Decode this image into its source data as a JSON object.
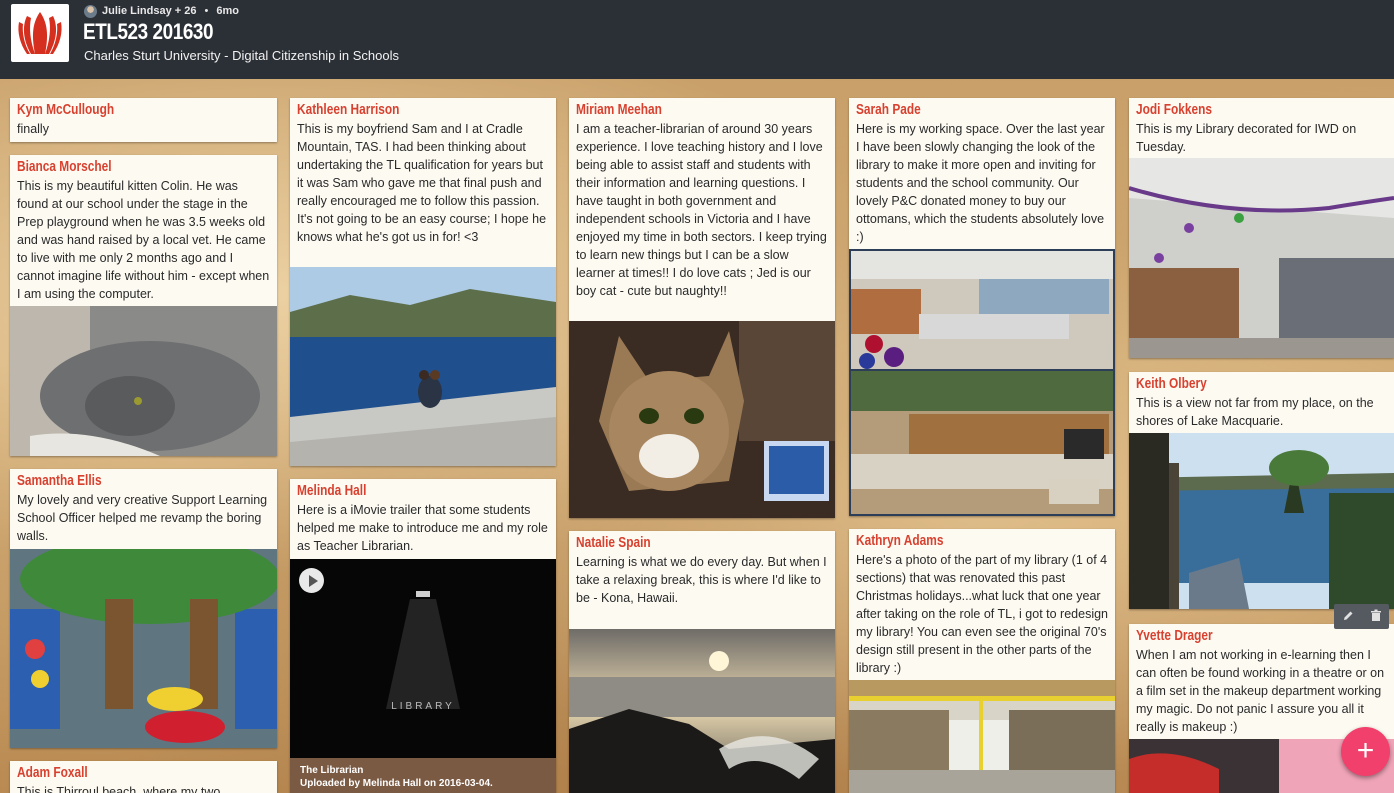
{
  "header": {
    "author_meta": "Julie Lindsay + 26",
    "age": "6mo",
    "title": "ETL523 201630",
    "subtitle": "Charles Sturt University - Digital Citizenship in Schools"
  },
  "posts": [
    {
      "author": "Kym McCullough",
      "text": "finally"
    },
    {
      "author": "Bianca Morschel",
      "text": "This is my beautiful kitten Colin. He was found at our school under the stage in the Prep playground when he was 3.5 weeks old and was hand raised by a local vet. He came to live with me only 2 months ago and I cannot imagine life without him - except when I am using the computer."
    },
    {
      "author": "Samantha Ellis",
      "text": "My lovely and very creative Support Learning School Officer helped me revamp the boring walls."
    },
    {
      "author": "Adam Foxall",
      "text": "This is Thirroul beach, where my two"
    },
    {
      "author": "Kathleen Harrison",
      "text": "This is my boyfriend Sam and I at Cradle Mountain, TAS. I had been thinking about undertaking the TL qualification for years but it was Sam who gave me that final push and really encouraged me to follow this passion. It's not going to be an easy course; I hope he knows what he's got us in for! <3"
    },
    {
      "author": "Melinda Hall",
      "text": "Here is a iMovie trailer that some students helped me make to introduce me and my role as Teacher Librarian."
    },
    {
      "author": "Miriam Meehan",
      "text": "I am a teacher-librarian of around 30 years experience. I love teaching history and I love being able to assist staff and students with their information and learning questions. I have taught in both government and independent schools in Victoria and I have enjoyed my time in both sectors. I keep trying to learn new things but I can be a slow learner at times!! I do love cats ; Jed is our boy cat - cute but naughty!!"
    },
    {
      "author": "Natalie Spain",
      "text": "Learning is what we do every day. But when I take a relaxing break, this is where I'd like to be - Kona, Hawaii."
    },
    {
      "author": "Sarah Pade",
      "text": "Here is my working space. Over the last year I have been slowly changing the look of the library to make it more open and inviting for students and the school community. Our lovely P&C donated money to buy our ottomans, which the students absolutely love :)"
    },
    {
      "author": "Kathryn Adams",
      "text": "Here's a photo of the part of my library (1 of 4 sections) that was renovated this past Christmas holidays...what luck that one year after taking on the role of TL, i got to redesign my library! You can even see the original 70's design still present in the other parts of the library :)"
    },
    {
      "author": "Jodi Fokkens",
      "text": "This is my Library decorated for IWD on Tuesday."
    },
    {
      "author": "Keith Olbery",
      "text": "This is a view not far from my place, on the shores of Lake Macquarie."
    },
    {
      "author": "Yvette Drager",
      "text": "When I am not working in e-learning then I can often be found working in a theatre or on a film set in the makeup department working my magic. Do not panic I assure you all it really is makeup :)"
    }
  ],
  "video": {
    "title": "The Librarian",
    "uploaded": "Uploaded by Melinda Hall on 2016-03-04.",
    "overlay_text": "LIBRARY"
  },
  "actions": {
    "edit_icon": "pencil-icon",
    "delete_icon": "trash-icon",
    "add_icon": "plus-icon",
    "add_label": "+"
  },
  "colors": {
    "header_bg": "#2b2f36",
    "author": "#d8412f",
    "fab": "#f0406b"
  }
}
